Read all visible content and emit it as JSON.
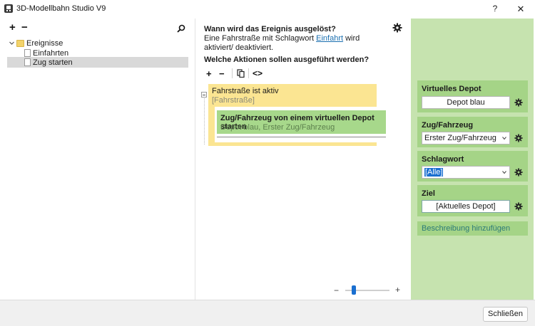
{
  "window": {
    "title": "3D-Modellbahn Studio V9",
    "help_label": "?",
    "close_label": "✕"
  },
  "left_pane": {
    "add_label": "+",
    "remove_label": "−",
    "tree": {
      "root": "Ereignisse",
      "children": [
        "Einfahrten",
        "Zug starten"
      ],
      "selected": "Zug starten"
    }
  },
  "center": {
    "trigger_question": "Wann wird das Ereignis ausgelöst?",
    "trigger_text_before": "Eine Fahrstraße mit Schlagwort ",
    "trigger_link": "Einfahrt",
    "trigger_text_after": " wird aktiviert/ deaktiviert.",
    "actions_question": "Welche Aktionen sollen ausgeführt werden?",
    "toolbar": {
      "add": "+",
      "remove": "−",
      "code": "<>"
    },
    "condition": {
      "title": "Fahrstraße ist aktiv",
      "subtitle": "[Fahrstraße]"
    },
    "action": {
      "title": "Zug/Fahrzeug von einem virtuellen Depot starten",
      "subtitle": "Depot blau, Erster Zug/Fahrzeug"
    },
    "zoom": {
      "minus": "−",
      "plus": "+",
      "level": 0.2
    }
  },
  "properties": {
    "virtual_depot": {
      "label": "Virtuelles Depot",
      "value": "Depot blau"
    },
    "vehicle": {
      "label": "Zug/Fahrzeug",
      "value": "Erster Zug/Fahrzeug"
    },
    "keyword": {
      "label": "Schlagwort",
      "value": "[Alle]"
    },
    "target": {
      "label": "Ziel",
      "value": "[Aktuelles Depot]"
    },
    "add_description": "Beschreibung hinzufügen"
  },
  "footer": {
    "close_button": "Schließen"
  },
  "colors": {
    "condition_yellow": "#fbe592",
    "action_green": "#a7d88b",
    "panel_green": "#c6e3af",
    "card_green": "#a5d487",
    "link_blue": "#1a6fb0"
  },
  "icons": [
    "app-icon",
    "search-icon",
    "gear-icon",
    "folder-icon",
    "document-icon",
    "copy-icon",
    "chevron-down-icon"
  ]
}
